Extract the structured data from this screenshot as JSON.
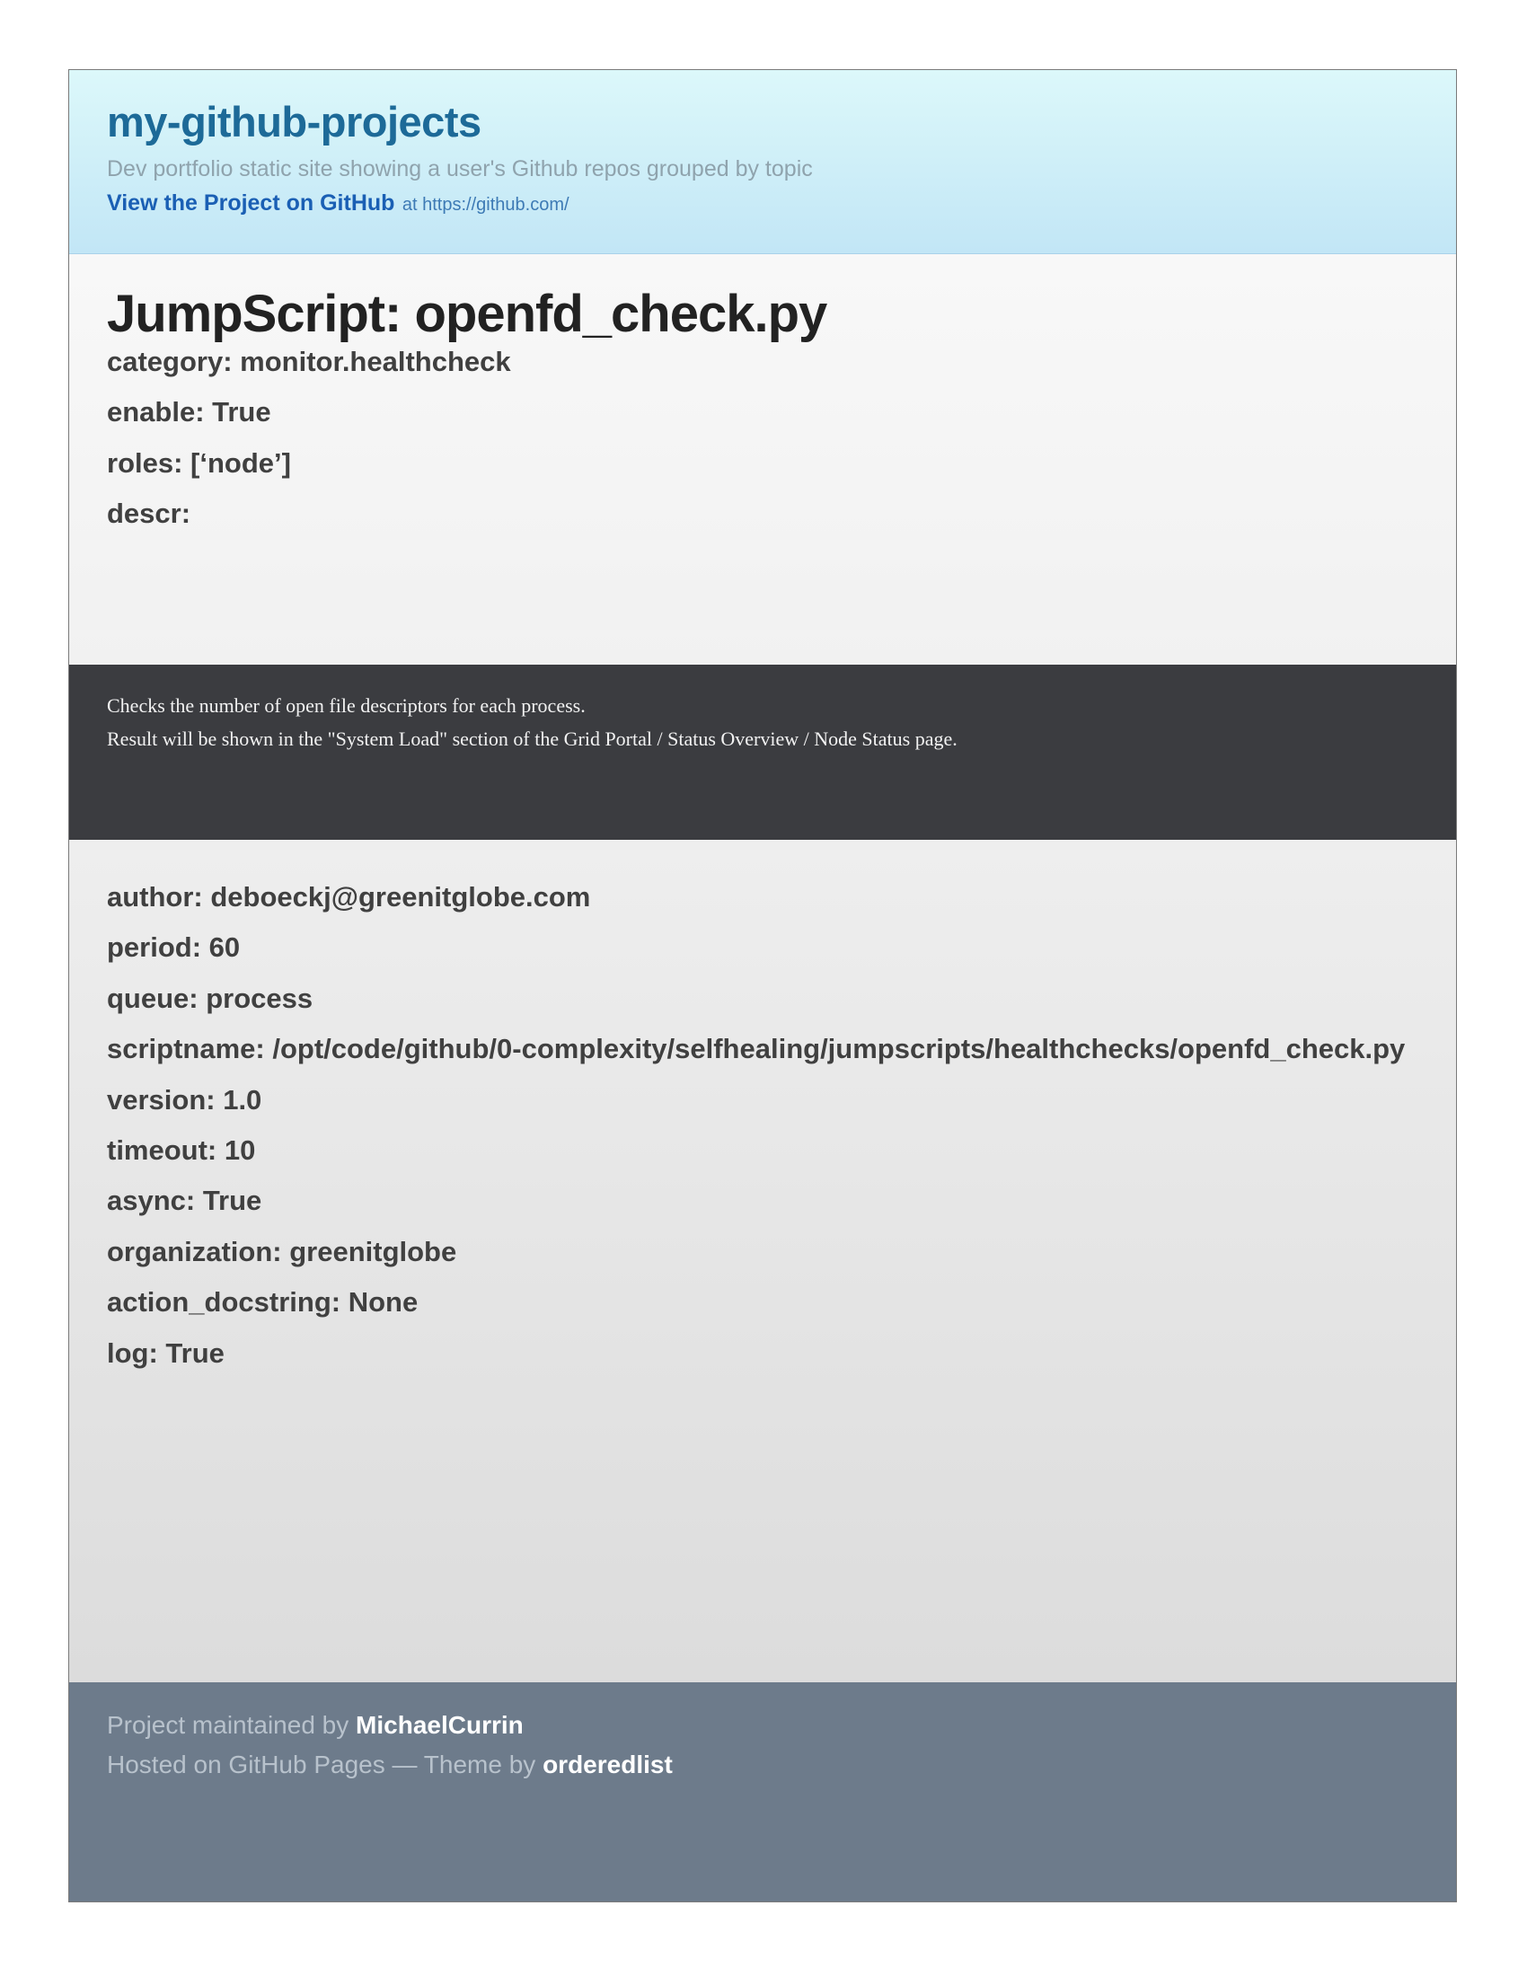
{
  "header": {
    "title": "my-github-projects",
    "tagline": "Dev portfolio static site showing a user's Github repos grouped by topic",
    "view_project_label": "View the Project on GitHub",
    "view_project_at": "at https://github.com/"
  },
  "main": {
    "title": "JumpScript: openfd_check.py",
    "fields_top": [
      "category: monitor.healthcheck",
      "enable: True",
      "roles: [‘node’]",
      "descr:"
    ],
    "description_lines": [
      "Checks the number of open file descriptors for each process.",
      "Result will be shown in the \"System Load\" section of the Grid Portal / Status Overview / Node Status page."
    ],
    "fields_bottom": [
      "author: deboeckj@greenitglobe.com",
      "period: 60",
      "queue: process",
      "scriptname: /opt/code/github/0-complexity/selfhealing/jumpscripts/healthchecks/openfd_check.py",
      "version: 1.0",
      "timeout: 10",
      "async: True",
      "organization: greenitglobe",
      "action_docstring: None",
      "log: True"
    ]
  },
  "footer": {
    "maintained_prefix": "Project maintained by",
    "maintainer": "MichaelCurrin",
    "hosted_prefix": "Hosted on GitHub Pages — Theme by",
    "theme_author": "orderedlist"
  },
  "colors": {
    "header_title": "#1d6a98",
    "link": "#1a5fb4",
    "description_bg": "#3b3c40",
    "footer_bg": "#6d7b8b"
  }
}
